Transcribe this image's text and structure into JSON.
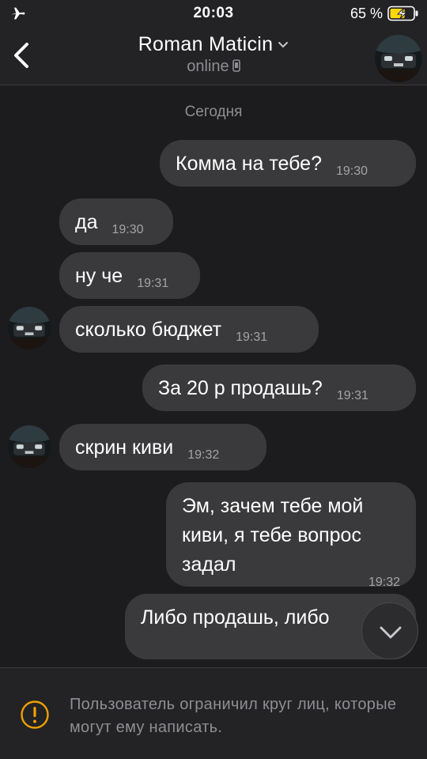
{
  "status_bar": {
    "time": "20:03",
    "battery_percent": "65 %",
    "battery_level": 0.65,
    "icons": [
      "airplane-icon",
      "battery-charging-icon"
    ]
  },
  "header": {
    "back_icon": "chevron-left-icon",
    "contact_name": "Roman Maticin",
    "presence": "online",
    "presence_icon": "phone-icon",
    "dropdown_icon": "chevron-down-icon"
  },
  "chat": {
    "date_divider": "Сегодня",
    "messages": [
      {
        "from": "me",
        "text": "Комма на тебе?",
        "time": "19:30"
      },
      {
        "from": "contact",
        "text": "да",
        "time": "19:30"
      },
      {
        "from": "contact",
        "text": "ну че",
        "time": "19:31"
      },
      {
        "from": "contact",
        "text": "сколько бюджет",
        "time": "19:31"
      },
      {
        "from": "me",
        "text": "За 20 р продашь?",
        "time": "19:31"
      },
      {
        "from": "contact",
        "text": "скрин киви",
        "time": "19:32"
      },
      {
        "from": "me",
        "text": "Эм, зачем тебе мой киви, я тебе вопрос задал",
        "time": "19:32"
      },
      {
        "from": "me",
        "text": "Либо продашь, либо",
        "time": ""
      }
    ]
  },
  "footer": {
    "notice": "Пользователь ограничил круг лиц, которые могут ему написать.",
    "notice_icon": "warning-circle-icon"
  },
  "colors": {
    "background": "#1c1c1e",
    "bar": "#232325",
    "bubble": "#3a3a3c",
    "secondary_text": "#8e8e93",
    "warning": "#f0a000",
    "battery_charge": "#ffd60a"
  }
}
